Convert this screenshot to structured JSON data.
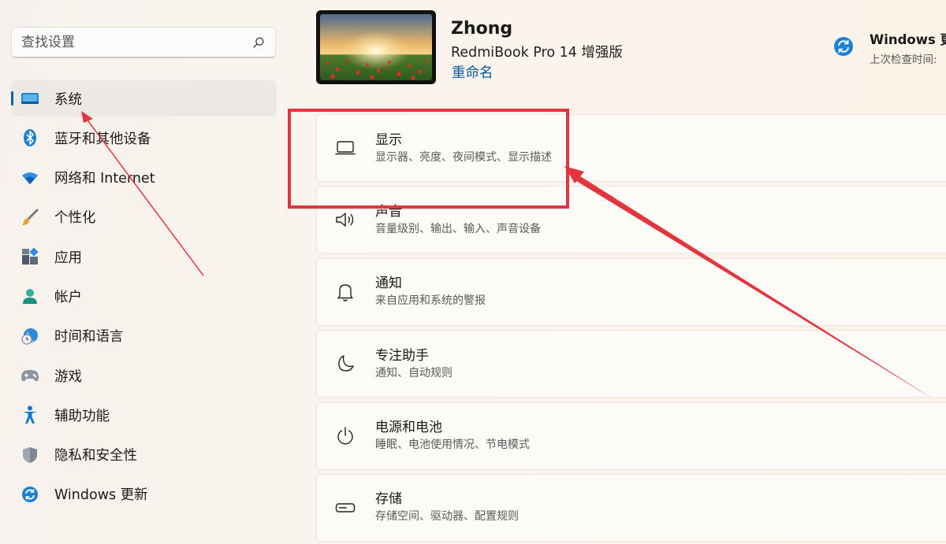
{
  "search": {
    "placeholder": "查找设置",
    "icon": "search-icon"
  },
  "sidebar": {
    "items": [
      {
        "label": "系统",
        "icon": "system-display-icon",
        "active": true
      },
      {
        "label": "蓝牙和其他设备",
        "icon": "bluetooth-icon"
      },
      {
        "label": "网络和 Internet",
        "icon": "wifi-icon"
      },
      {
        "label": "个性化",
        "icon": "brush-icon"
      },
      {
        "label": "应用",
        "icon": "apps-icon"
      },
      {
        "label": "帐户",
        "icon": "account-icon"
      },
      {
        "label": "时间和语言",
        "icon": "time-language-icon"
      },
      {
        "label": "游戏",
        "icon": "gamepad-icon"
      },
      {
        "label": "辅助功能",
        "icon": "accessibility-icon"
      },
      {
        "label": "隐私和安全性",
        "icon": "shield-icon"
      },
      {
        "label": "Windows 更新",
        "icon": "windows-update-icon"
      }
    ]
  },
  "device": {
    "name": "Zhong",
    "model": "RedmiBook Pro 14 增强版",
    "rename": "重命名"
  },
  "update": {
    "title": "Windows 更",
    "subtitle": "上次检查时间:"
  },
  "cards": [
    {
      "title": "显示",
      "desc": "显示器、亮度、夜间模式、显示描述",
      "icon": "laptop-icon"
    },
    {
      "title": "声音",
      "desc": "音量级别、输出、输入、声音设备",
      "icon": "speaker-icon"
    },
    {
      "title": "通知",
      "desc": "来自应用和系统的警报",
      "icon": "bell-icon"
    },
    {
      "title": "专注助手",
      "desc": "通知、自动规则",
      "icon": "moon-icon"
    },
    {
      "title": "电源和电池",
      "desc": "睡眠、电池使用情况、节电模式",
      "icon": "power-icon"
    },
    {
      "title": "存储",
      "desc": "存储空间、驱动器、配置规则",
      "icon": "storage-drive-icon"
    }
  ],
  "colors": {
    "accent": "#0a5fb4",
    "annotation": "#e2353d"
  }
}
